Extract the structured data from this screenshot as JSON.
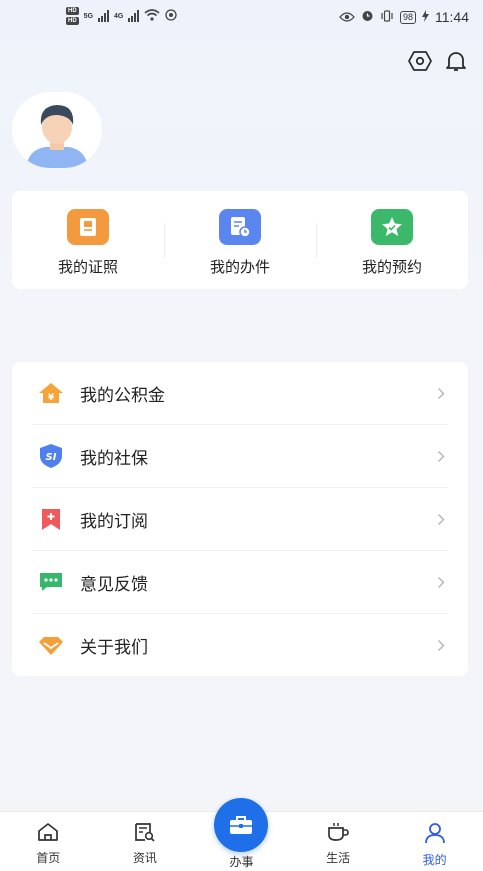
{
  "status_bar": {
    "hd1": "HD",
    "hd2": "HD",
    "net1": "5G",
    "net2": "4G",
    "battery": "98",
    "time": "11:44"
  },
  "header": {
    "settings_icon": "hexagon-settings-icon",
    "bell_icon": "bell-icon"
  },
  "quick_actions": [
    {
      "label": "我的证照",
      "icon": "certificate-icon",
      "color": "#f29a3d"
    },
    {
      "label": "我的办件",
      "icon": "document-clock-icon",
      "color": "#5b86f0"
    },
    {
      "label": "我的预约",
      "icon": "star-badge-icon",
      "color": "#3bb86a"
    }
  ],
  "menu": [
    {
      "label": "我的公积金",
      "icon": "housing-fund-icon",
      "color": "#f6a43a"
    },
    {
      "label": "我的社保",
      "icon": "social-security-shield-icon",
      "color": "#4f80ee"
    },
    {
      "label": "我的订阅",
      "icon": "bookmark-plus-icon",
      "color": "#f05a5a"
    },
    {
      "label": "意见反馈",
      "icon": "chat-bubble-icon",
      "color": "#35b86c"
    },
    {
      "label": "关于我们",
      "icon": "diamond-icon",
      "color": "#f4a03a"
    }
  ],
  "bottom_nav": [
    {
      "label": "首页",
      "icon": "home-icon"
    },
    {
      "label": "资讯",
      "icon": "news-search-icon"
    },
    {
      "label": "办事",
      "icon": "briefcase-icon"
    },
    {
      "label": "生活",
      "icon": "coffee-cup-icon"
    },
    {
      "label": "我的",
      "icon": "user-icon",
      "active": true
    }
  ],
  "colors": {
    "accent": "#1f6fe8",
    "active_nav": "#2f5bea"
  }
}
